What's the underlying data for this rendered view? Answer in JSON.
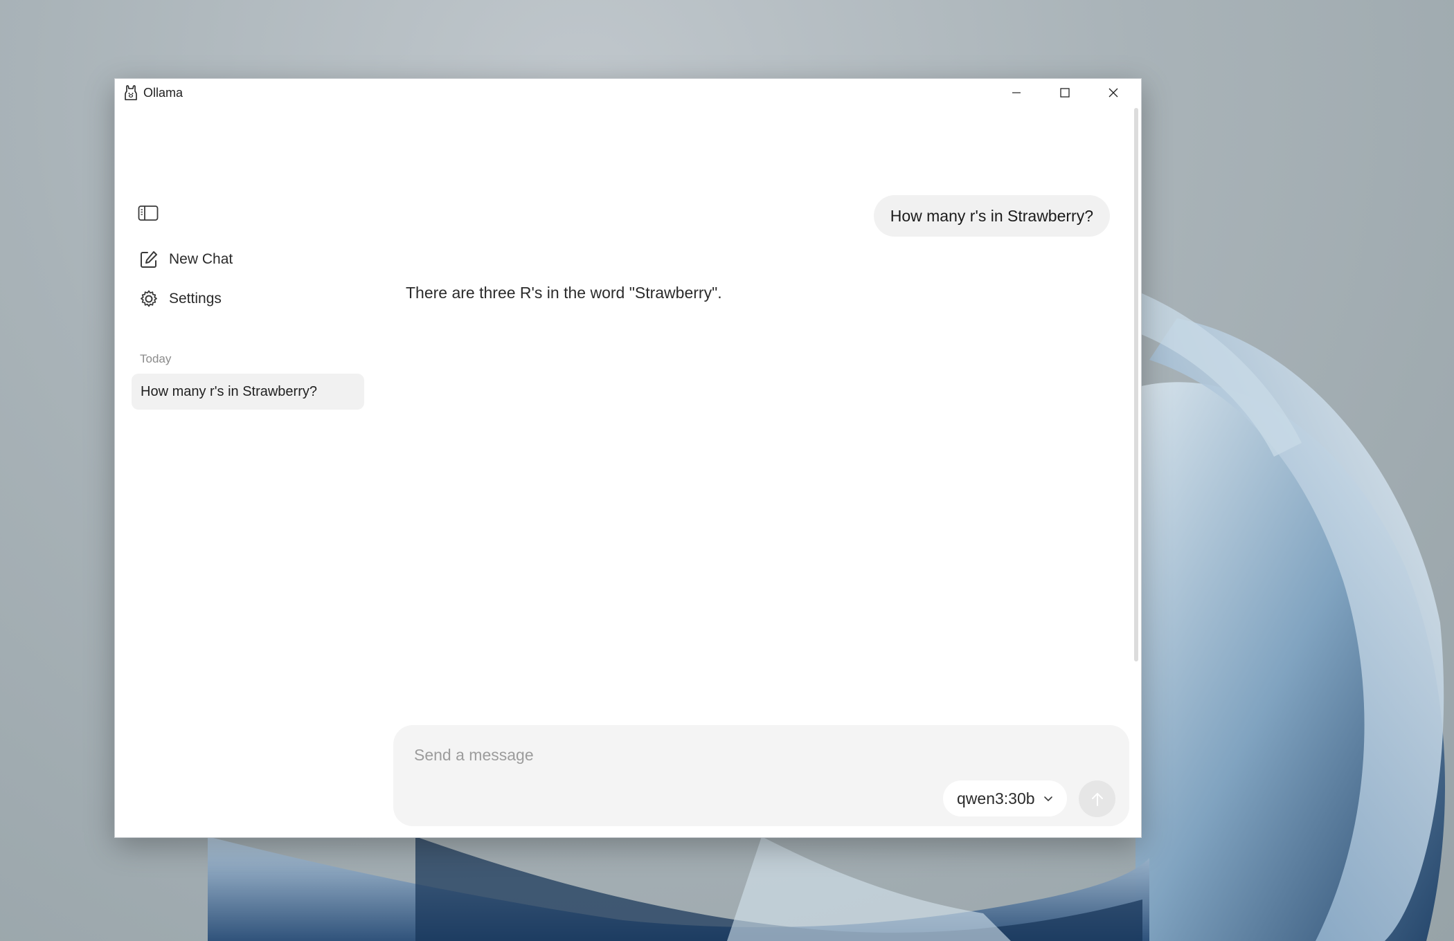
{
  "window": {
    "title": "Ollama",
    "controls": {
      "minimize_icon": "minimize-icon",
      "maximize_icon": "maximize-icon",
      "close_icon": "close-icon"
    }
  },
  "sidebar": {
    "toggle_icon": "sidebar-toggle-icon",
    "items": [
      {
        "label": "New Chat",
        "icon": "new-chat-icon"
      },
      {
        "label": "Settings",
        "icon": "gear-icon"
      }
    ],
    "history": {
      "section_label": "Today",
      "chats": [
        {
          "title": "How many r's in Strawberry?",
          "selected": true
        }
      ]
    }
  },
  "conversation": {
    "messages": [
      {
        "role": "user",
        "text": "How many r's in Strawberry?"
      },
      {
        "role": "assistant",
        "text": "There are three R's in the word \"Strawberry\"."
      }
    ]
  },
  "composer": {
    "placeholder": "Send a message",
    "value": "",
    "model": "qwen3:30b",
    "send_icon": "arrow-up-icon"
  },
  "colors": {
    "bubble_bg": "#f1f1f1",
    "composer_bg": "#f4f4f4",
    "send_disabled": "#e6e6e6"
  }
}
